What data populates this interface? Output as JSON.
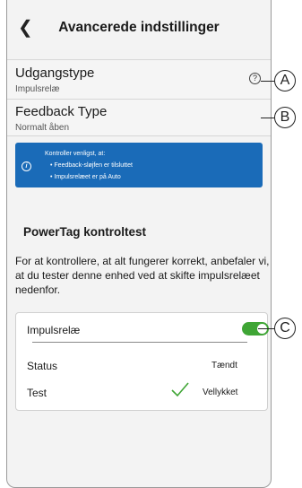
{
  "header": {
    "title": "Avancerede indstillinger",
    "back_icon": "chevron-left-icon"
  },
  "settings": [
    {
      "label": "Udgangstype",
      "value": "Impulsrelæ",
      "help": "?"
    },
    {
      "label": "Feedback Type",
      "value": "Normalt åben"
    }
  ],
  "info": {
    "heading": "Kontroller venligst, at:",
    "bullet1": "• Feedback-sløjfen er tilsluttet",
    "bullet2": "• Impulsrelæet er på Auto",
    "icon_text": "i"
  },
  "test_section": {
    "title": "PowerTag kontroltest",
    "description": "For at kontrollere, at alt fungerer korrekt, anbefaler vi, at du tester denne enhed ved at skifte impulsrelæet nedenfor."
  },
  "card": {
    "relay_label": "Impulsrelæ",
    "relay_on": true,
    "status_label": "Status",
    "status_value": "Tændt",
    "test_label": "Test",
    "test_value": "Vellykket"
  },
  "callouts": {
    "a": "A",
    "b": "B",
    "c": "C"
  },
  "colors": {
    "toggle_on": "#3fa535",
    "info_bg": "#1a6bb8",
    "check": "#3fa535"
  }
}
